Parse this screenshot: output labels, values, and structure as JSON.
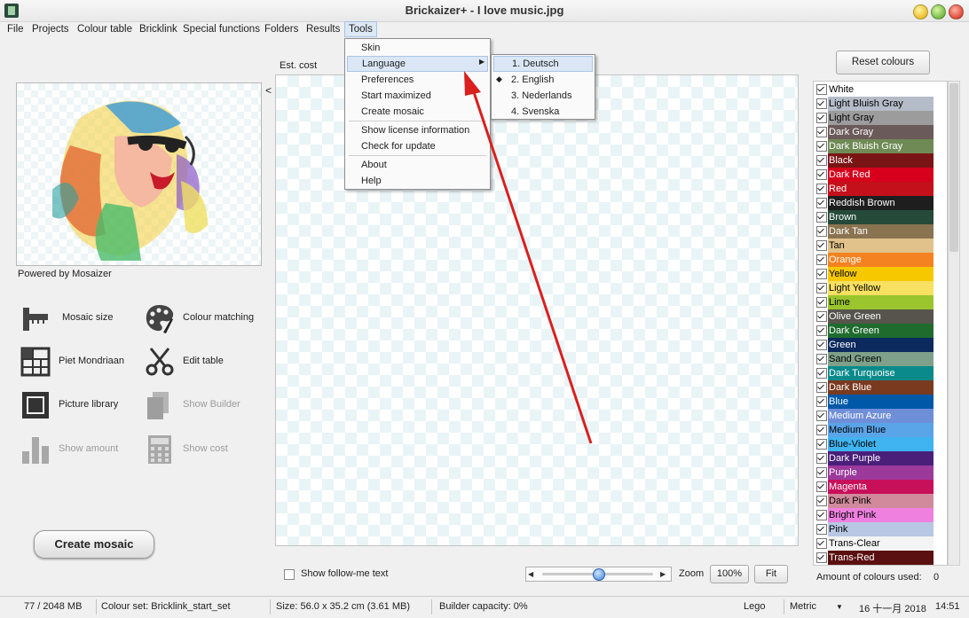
{
  "window": {
    "title": "Brickaizer+  - I love music.jpg"
  },
  "menubar": [
    "File",
    "Projects",
    "Colour table",
    "Bricklink",
    "Special functions",
    "Folders",
    "Results",
    "Tools"
  ],
  "tools_menu": {
    "items": [
      "Skin",
      "Language",
      "Preferences",
      "Start maximized",
      "Create mosaic",
      "Show license information",
      "Check for update",
      "About",
      "Help"
    ]
  },
  "language_menu": {
    "items": [
      "1.  Deutsch",
      "2.  English",
      "3.  Nederlands",
      "4.  Svenska"
    ],
    "selected": "2.  English"
  },
  "left": {
    "collapse": "<",
    "powered_by": "Powered by Mosaizer",
    "tools": {
      "mosaic_size": "Mosaic size",
      "colour_matching": "Colour matching",
      "piet_mondriaan": "Piet Mondriaan",
      "edit_table": "Edit table",
      "picture_library": "Picture library",
      "show_builder": "Show Builder",
      "show_amount": "Show amount",
      "show_cost": "Show cost"
    },
    "create_mosaic": "Create mosaic"
  },
  "canvas": {
    "est_cost_label": "Est. cost",
    "follow_me_label": "Show follow-me text",
    "zoom_label": "Zoom",
    "zoom_value": "100%",
    "fit_label": "Fit",
    "slider_level": 0.5
  },
  "colours": {
    "reset_label": "Reset colours",
    "amount_label": "Amount of colours used:",
    "amount_value": "0",
    "list": [
      {
        "name": "White",
        "color": "#ffffff",
        "text": "#000000"
      },
      {
        "name": "Light Bluish Gray",
        "color": "#b4bcc8",
        "text": "#000000"
      },
      {
        "name": "Light Gray",
        "color": "#9c9c9c",
        "text": "#000000"
      },
      {
        "name": "Dark Gray",
        "color": "#6b5a5a",
        "text": "#ffffff"
      },
      {
        "name": "Dark Bluish Gray",
        "color": "#6f8a55",
        "text": "#ffffff"
      },
      {
        "name": "Black",
        "color": "#7a1515",
        "text": "#ffffff"
      },
      {
        "name": "Dark Red",
        "color": "#d6001c",
        "text": "#ffffff"
      },
      {
        "name": "Red",
        "color": "#c4101a",
        "text": "#ffffff"
      },
      {
        "name": "Reddish Brown",
        "color": "#1e1e1e",
        "text": "#ffffff"
      },
      {
        "name": "Brown",
        "color": "#254a3a",
        "text": "#ffffff"
      },
      {
        "name": "Dark Tan",
        "color": "#8a7350",
        "text": "#ffffff"
      },
      {
        "name": "Tan",
        "color": "#e0c28a",
        "text": "#000000"
      },
      {
        "name": "Orange",
        "color": "#f58220",
        "text": "#ffffff"
      },
      {
        "name": "Yellow",
        "color": "#f5c800",
        "text": "#000000"
      },
      {
        "name": "Light Yellow",
        "color": "#f8e060",
        "text": "#000000"
      },
      {
        "name": "Lime",
        "color": "#9bc52c",
        "text": "#000000"
      },
      {
        "name": "Olive Green",
        "color": "#56544c",
        "text": "#ffffff"
      },
      {
        "name": "Dark Green",
        "color": "#1f6b2e",
        "text": "#ffffff"
      },
      {
        "name": "Green",
        "color": "#0c2a5e",
        "text": "#ffffff"
      },
      {
        "name": "Sand Green",
        "color": "#7fa08a",
        "text": "#000000"
      },
      {
        "name": "Dark Turquoise",
        "color": "#0a8a8a",
        "text": "#ffffff"
      },
      {
        "name": "Dark Blue",
        "color": "#7a3a20",
        "text": "#ffffff"
      },
      {
        "name": "Blue",
        "color": "#0058a8",
        "text": "#ffffff"
      },
      {
        "name": "Medium Azure",
        "color": "#6f8ed8",
        "text": "#ffffff"
      },
      {
        "name": "Medium Blue",
        "color": "#5aa4e8",
        "text": "#000000"
      },
      {
        "name": "Blue-Violet",
        "color": "#3fb4f0",
        "text": "#000000"
      },
      {
        "name": "Dark Purple",
        "color": "#4a1f7a",
        "text": "#ffffff"
      },
      {
        "name": "Purple",
        "color": "#9c3a9c",
        "text": "#ffffff"
      },
      {
        "name": "Magenta",
        "color": "#c8105a",
        "text": "#ffffff"
      },
      {
        "name": "Dark Pink",
        "color": "#d08a9c",
        "text": "#000000"
      },
      {
        "name": "Bright Pink",
        "color": "#f080e0",
        "text": "#000000"
      },
      {
        "name": "Pink",
        "color": "#b8c8e4",
        "text": "#000000"
      },
      {
        "name": "Trans-Clear",
        "color": "#f4f4f4",
        "text": "#000000"
      },
      {
        "name": "Trans-Red",
        "color": "#5a1010",
        "text": "#ffffff"
      }
    ]
  },
  "status": {
    "memory": "77 / 2048 MB",
    "colour_set": "Colour set: Bricklink_start_set",
    "size": "Size: 56.0 x 35.2 cm (3.61 MB)",
    "builder_capacity": "Builder capacity: 0%",
    "brand": "Lego",
    "unit": "Metric",
    "date": "16 十一月 2018",
    "time": "14:51"
  },
  "accent": "#d9201e"
}
